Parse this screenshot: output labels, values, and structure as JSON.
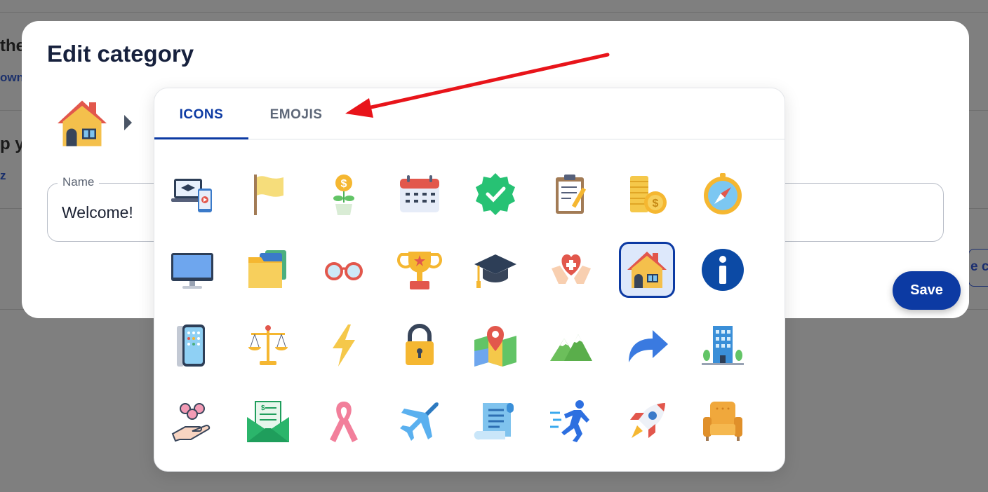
{
  "background": {
    "heading_1": "the",
    "link_1": "own",
    "heading_2": "p y",
    "link_2": "z",
    "button_fragment": "e c"
  },
  "modal": {
    "title": "Edit category",
    "preview_icon": "house-icon",
    "name_field": {
      "label": "Name",
      "value": "Welcome!"
    },
    "save_label": "Save"
  },
  "picker": {
    "tabs": [
      {
        "label": "ICONS",
        "active": true
      },
      {
        "label": "EMOJIS",
        "active": false
      }
    ],
    "icons": [
      "online-learning-icon",
      "flag-icon",
      "money-plant-icon",
      "calendar-icon",
      "verified-badge-icon",
      "clipboard-icon",
      "coins-icon",
      "compass-icon",
      "monitor-icon",
      "folders-icon",
      "glasses-icon",
      "trophy-icon",
      "graduation-cap-icon",
      "healthcare-hands-icon",
      "house-icon",
      "info-icon",
      "smartphone-icon",
      "scales-icon",
      "lightning-icon",
      "padlock-icon",
      "map-pin-icon",
      "mountains-icon",
      "share-arrow-icon",
      "office-building-icon",
      "community-care-icon",
      "envelope-money-icon",
      "awareness-ribbon-icon",
      "airplane-icon",
      "scroll-icon",
      "running-man-icon",
      "rocket-icon",
      "armchair-icon"
    ],
    "selected_icon": "house-icon"
  },
  "colors": {
    "accent": "#0c3aa3",
    "title": "#17213d",
    "annotation_arrow": "#e8141a"
  }
}
